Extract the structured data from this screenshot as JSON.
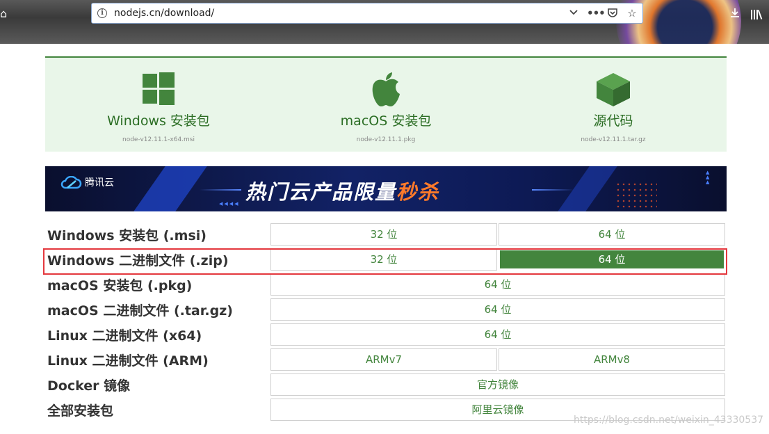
{
  "browser": {
    "url": "nodejs.cn/download/",
    "icons": [
      "home-icon",
      "info-icon",
      "chevron-down-icon",
      "more-icon",
      "pocket-icon",
      "bookmark-star-icon",
      "download-icon",
      "library-icon"
    ]
  },
  "cards": [
    {
      "title": "Windows 安装包",
      "file": "node-v12.11.1-x64.msi",
      "icon": "windows-icon"
    },
    {
      "title": "macOS 安装包",
      "file": "node-v12.11.1.pkg",
      "icon": "apple-icon"
    },
    {
      "title": "源代码",
      "file": "node-v12.11.1.tar.gz",
      "icon": "box-icon"
    }
  ],
  "banner": {
    "brand": "腾讯云",
    "headline_prefix": "热门云产品限量",
    "headline_hot": "秒杀"
  },
  "downloads": [
    {
      "label": "Windows 安装包 (.msi)",
      "buttons": [
        "32 位",
        "64 位"
      ]
    },
    {
      "label": "Windows 二进制文件 (.zip)",
      "buttons": [
        "32 位",
        "64 位"
      ],
      "active_button": "64 位"
    },
    {
      "label": "macOS 安装包 (.pkg)",
      "buttons": [
        "64 位"
      ]
    },
    {
      "label": "macOS 二进制文件 (.tar.gz)",
      "buttons": [
        "64 位"
      ]
    },
    {
      "label": "Linux 二进制文件 (x64)",
      "buttons": [
        "64 位"
      ]
    },
    {
      "label": "Linux 二进制文件 (ARM)",
      "buttons": [
        "ARMv7",
        "ARMv8"
      ]
    },
    {
      "label": "Docker 镜像",
      "buttons": [
        "官方镜像"
      ]
    },
    {
      "label": "全部安装包",
      "buttons": [
        "阿里云镜像"
      ]
    }
  ],
  "watermark": "https://blog.csdn.net/weixin_43330537",
  "colors": {
    "brand_green": "#43853d",
    "card_bg": "#e9f6e9",
    "highlight_red": "#e4383e",
    "hot_orange": "#ff7a2a"
  }
}
